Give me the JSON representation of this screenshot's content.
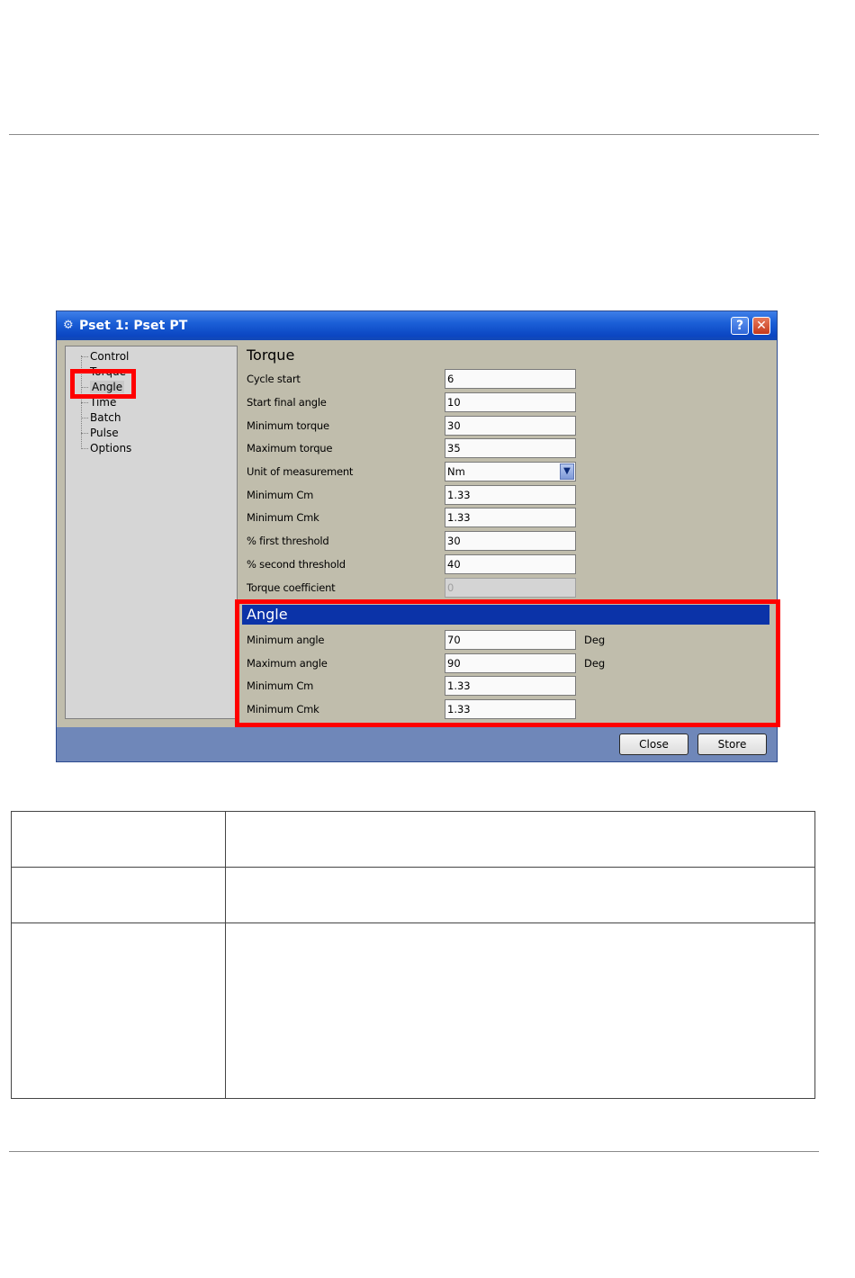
{
  "window": {
    "title": "Pset 1: Pset PT",
    "help_label": "?",
    "close_label": "✕"
  },
  "tree": {
    "items": [
      {
        "label": "Control"
      },
      {
        "label": "Torque"
      },
      {
        "label": "Angle"
      },
      {
        "label": "Time"
      },
      {
        "label": "Batch"
      },
      {
        "label": "Pulse"
      },
      {
        "label": "Options"
      }
    ],
    "selected": "Angle"
  },
  "torque": {
    "title": "Torque",
    "rows": [
      {
        "label": "Cycle start",
        "value": "6"
      },
      {
        "label": "Start final angle",
        "value": "10"
      },
      {
        "label": "Minimum torque",
        "value": "30"
      },
      {
        "label": "Maximum torque",
        "value": "35"
      },
      {
        "label": "Unit of measurement",
        "value": "Nm"
      },
      {
        "label": "Minimum Cm",
        "value": "1.33"
      },
      {
        "label": "Minimum Cmk",
        "value": "1.33"
      },
      {
        "label": "% first threshold",
        "value": "30"
      },
      {
        "label": "% second threshold",
        "value": "40"
      },
      {
        "label": "Torque coefficient",
        "value": "0"
      }
    ]
  },
  "angle": {
    "title": "Angle",
    "rows": [
      {
        "label": "Minimum angle",
        "value": "70",
        "unit": "Deg"
      },
      {
        "label": "Maximum angle",
        "value": "90",
        "unit": "Deg"
      },
      {
        "label": "Minimum Cm",
        "value": "1.33"
      },
      {
        "label": "Minimum Cmk",
        "value": "1.33"
      }
    ]
  },
  "buttons": {
    "close": "Close",
    "store": "Store"
  },
  "colors": {
    "highlight": "#ff0000",
    "section_header": "#0b33a8",
    "panel": "#c0bdac"
  }
}
